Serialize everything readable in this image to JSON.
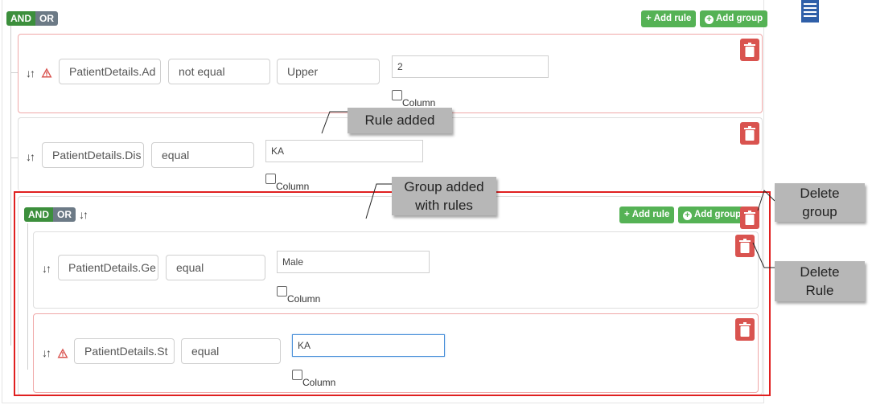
{
  "root": {
    "and_label": "AND",
    "or_label": "OR",
    "add_rule_label": "Add rule",
    "add_group_label": "Add group"
  },
  "rules": [
    {
      "field": "PatientDetails.Ad",
      "operator": "not equal",
      "modifier": "Upper",
      "value": "2",
      "column_label": "Column",
      "error": true
    },
    {
      "field": "PatientDetails.Dis",
      "operator": "equal",
      "value": "KA",
      "column_label": "Column",
      "error": false
    }
  ],
  "group": {
    "and_label": "AND",
    "or_label": "OR",
    "add_rule_label": "Add rule",
    "add_group_label": "Add group",
    "rules": [
      {
        "field": "PatientDetails.Ge",
        "operator": "equal",
        "value": "Male",
        "column_label": "Column",
        "error": false
      },
      {
        "field": "PatientDetails.St",
        "operator": "equal",
        "value": "KA",
        "column_label": "Column",
        "error": true,
        "focused": true
      }
    ]
  },
  "callouts": {
    "rule_added": "Rule added",
    "group_added_line1": "Group added",
    "group_added_line2": "with rules",
    "delete_group_line1": "Delete",
    "delete_group_line2": "group",
    "delete_rule_line1": "Delete",
    "delete_rule_line2": "Rule"
  },
  "icons": {
    "menu": "list-icon",
    "trash": "trash-icon",
    "warning": "warning-icon",
    "drag": "sort-arrows-icon"
  },
  "colors": {
    "and": "#3c8f3c",
    "or": "#6c7a86",
    "add_button": "#55b255",
    "delete_button": "#d9534f",
    "error_border": "#f0a8a8",
    "highlight": "#e02020",
    "callout": "#b7b7b7",
    "menu_icon": "#2f5fa8"
  }
}
